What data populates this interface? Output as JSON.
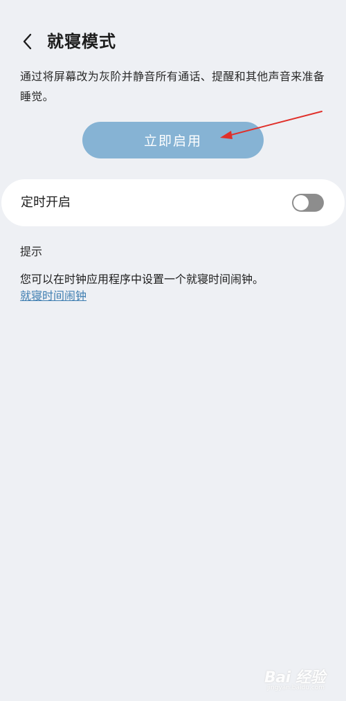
{
  "header": {
    "title": "就寝模式"
  },
  "description": "通过将屏幕改为灰阶并静音所有通话、提醒和其他声音来准备睡觉。",
  "enable_button": {
    "label": "立即启用"
  },
  "schedule_card": {
    "label": "定时开启",
    "toggle_state": "off"
  },
  "tips": {
    "heading": "提示",
    "text": "您可以在时钟应用程序中设置一个就寝时间闹钟。",
    "link": "就寝时间闹钟"
  },
  "annotation": {
    "color": "#e0302a"
  },
  "watermark": {
    "text": "Bai 经验",
    "sub": "jingyan.baidu.com"
  },
  "colors": {
    "background": "#eef0f4",
    "button": "#86b3d4",
    "link": "#3d7db0",
    "toggle_off": "#8d8d8d"
  }
}
